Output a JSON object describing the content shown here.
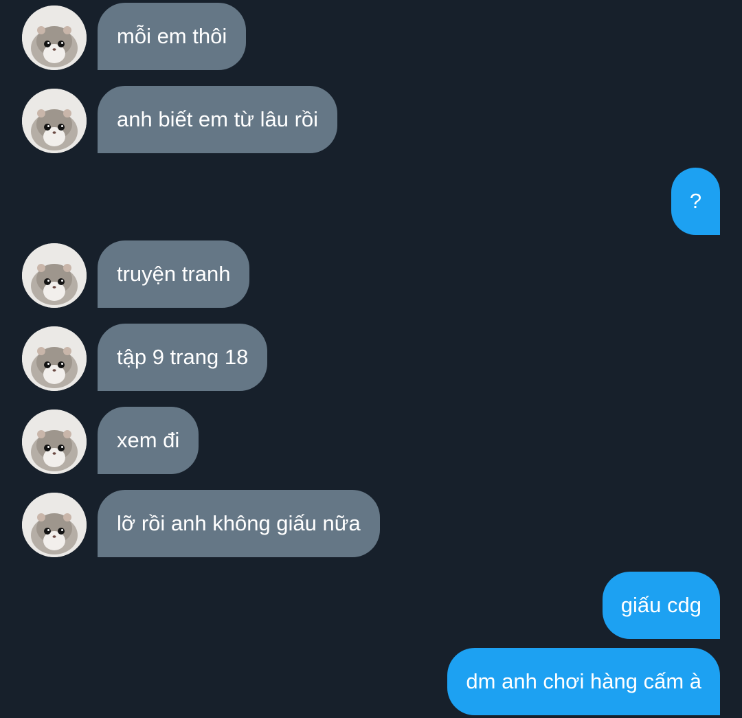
{
  "conversation": {
    "messages": [
      {
        "sender": "other",
        "text": "mỗi em thôi"
      },
      {
        "sender": "other",
        "text": "anh biết em từ lâu rồi"
      },
      {
        "sender": "me",
        "text": "?"
      },
      {
        "sender": "other",
        "text": "truyện tranh"
      },
      {
        "sender": "other",
        "text": "tập 9 trang 18"
      },
      {
        "sender": "other",
        "text": "xem đi"
      },
      {
        "sender": "other",
        "text": "lỡ rồi anh không giấu nữa"
      },
      {
        "sender": "me",
        "text": "giấu cdg"
      },
      {
        "sender": "me",
        "text": "dm anh chơi hàng cấm à"
      }
    ],
    "avatar_icon": "hamster-avatar-icon"
  },
  "colors": {
    "background": "#17202b",
    "incoming_bubble": "#657786",
    "outgoing_bubble": "#1da1f2",
    "text": "#ffffff"
  }
}
